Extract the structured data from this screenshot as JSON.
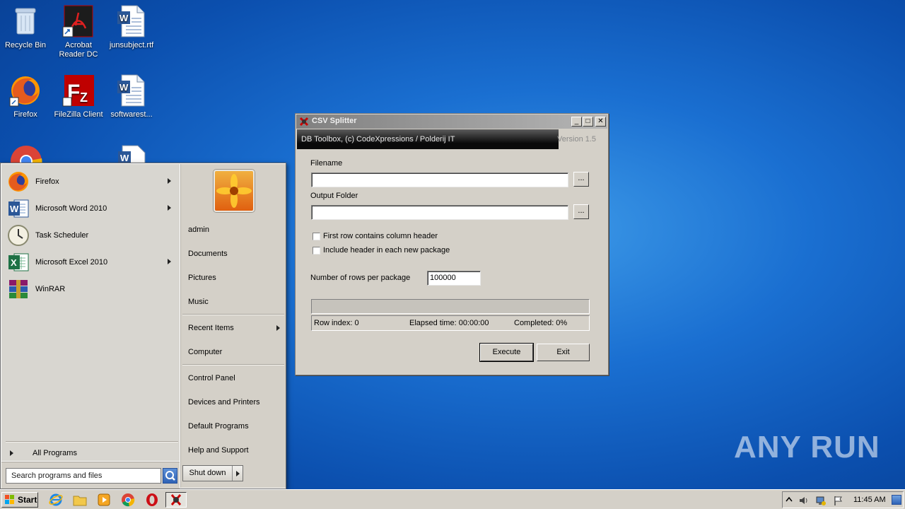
{
  "desktop": {
    "icons": [
      {
        "label": "Recycle Bin"
      },
      {
        "label": "Acrobat Reader DC"
      },
      {
        "label": "junsubject.rtf"
      },
      {
        "label": "Firefox"
      },
      {
        "label": "FileZilla Client"
      },
      {
        "label": "softwarest..."
      }
    ]
  },
  "start_menu": {
    "pinned": [
      {
        "label": "Firefox"
      },
      {
        "label": "Microsoft Word 2010"
      },
      {
        "label": "Task Scheduler"
      },
      {
        "label": "Microsoft Excel 2010"
      },
      {
        "label": "WinRAR"
      }
    ],
    "all_programs": "All Programs",
    "search_placeholder": "Search programs and files",
    "right": {
      "user": "admin",
      "documents": "Documents",
      "pictures": "Pictures",
      "music": "Music",
      "recent_items": "Recent Items",
      "computer": "Computer",
      "control_panel": "Control Panel",
      "devices_printers": "Devices and Printers",
      "default_programs": "Default Programs",
      "help_support": "Help and Support"
    },
    "shutdown": "Shut down"
  },
  "app": {
    "title": "CSV Splitter",
    "banner": "DB Toolbox, (c) CodeXpressions / Polderij IT",
    "version": "Version 1.5",
    "filename_label": "Filename",
    "filename_value": "",
    "output_label": "Output Folder",
    "output_value": "",
    "browse": "...",
    "chk_first_row": "First row contains column header",
    "chk_include_header": "Include header in each new package",
    "rows_label": "Number of rows per package",
    "rows_value": "100000",
    "progress": 0,
    "status": {
      "row_index": "Row index:  0",
      "elapsed": "Elapsed time:  00:00:00",
      "completed": "Completed:  0%"
    },
    "execute": "Execute",
    "exit": "Exit"
  },
  "taskbar": {
    "start": "Start",
    "clock": "11:45 AM"
  },
  "watermark": "ANY RUN",
  "colors": {
    "desktop_blue": "#1a6fd1",
    "window_face": "#d4d0c8"
  }
}
